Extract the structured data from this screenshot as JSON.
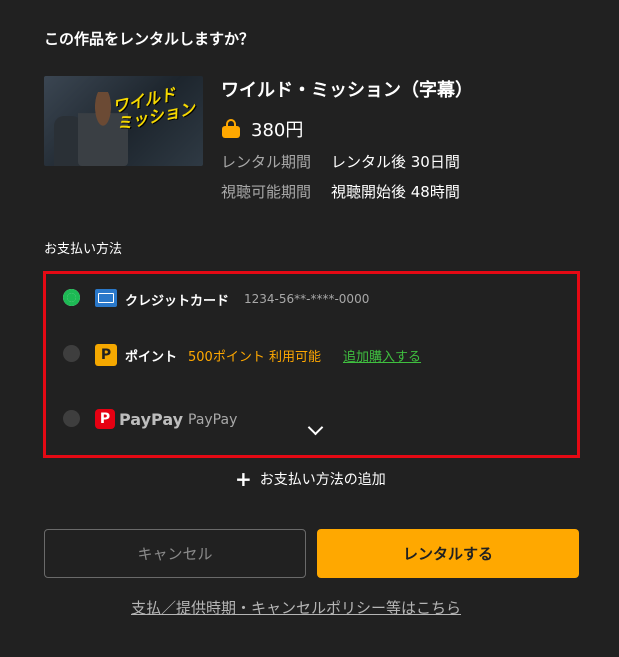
{
  "dialog": {
    "question": "この作品をレンタルしますか？"
  },
  "movie": {
    "title": "ワイルド・ミッション（字幕）",
    "poster_text_line1": "ワイルド",
    "poster_text_line2": "ミッション",
    "price": "380円",
    "rental_period_label": "レンタル期間",
    "rental_period_value": "レンタル後 30日間",
    "viewing_period_label": "視聴可能期間",
    "viewing_period_value": "視聴開始後 48時間"
  },
  "payment": {
    "section_label": "お支払い方法",
    "credit": {
      "label": "クレジットカード",
      "number": "1234-56**-****-0000",
      "selected": true
    },
    "points": {
      "icon_text": "P",
      "label": "ポイント",
      "available": "500ポイント 利用可能",
      "buy_more": "追加購入する",
      "selected": false
    },
    "paypay": {
      "logo_text": "PayPay",
      "label": "PayPay",
      "selected": false
    },
    "add_method": "お支払い方法の追加"
  },
  "buttons": {
    "cancel": "キャンセル",
    "rent": "レンタルする"
  },
  "policy_link": "支払／提供時期・キャンセルポリシー等はこちら",
  "colors": {
    "background": "#212121",
    "accent": "#ffa800",
    "selected_radio": "#1db954",
    "highlight_border": "#e50914",
    "link_green": "#3fbf3f"
  },
  "icons": {
    "price": "shopping-bag-icon",
    "credit": "amex-card-icon",
    "points": "points-p-icon",
    "paypay": "paypay-icon",
    "expand": "chevron-down-icon",
    "add": "plus-icon"
  }
}
